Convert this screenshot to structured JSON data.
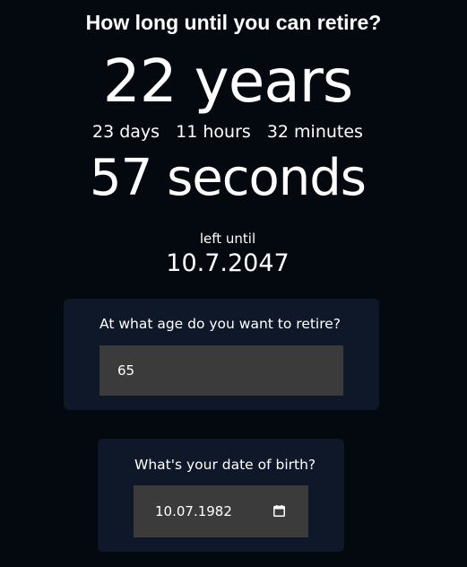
{
  "header": {
    "title": "How long until you can retire?"
  },
  "countdown": {
    "years": "22 years",
    "days": "23 days",
    "hours": "11 hours",
    "minutes": "32 minutes",
    "seconds": "57 seconds",
    "left_until_label": "left until",
    "target_date": "10.7.2047"
  },
  "age_card": {
    "label": "At what age do you want to retire?",
    "value": "65"
  },
  "dob_card": {
    "label": "What's your date of birth?",
    "value": "10.07.1982",
    "icon": "calendar-icon"
  },
  "colors": {
    "background": "#04080f",
    "card": "#0f1829",
    "input": "#3b3b3b",
    "text": "#ffffff"
  }
}
